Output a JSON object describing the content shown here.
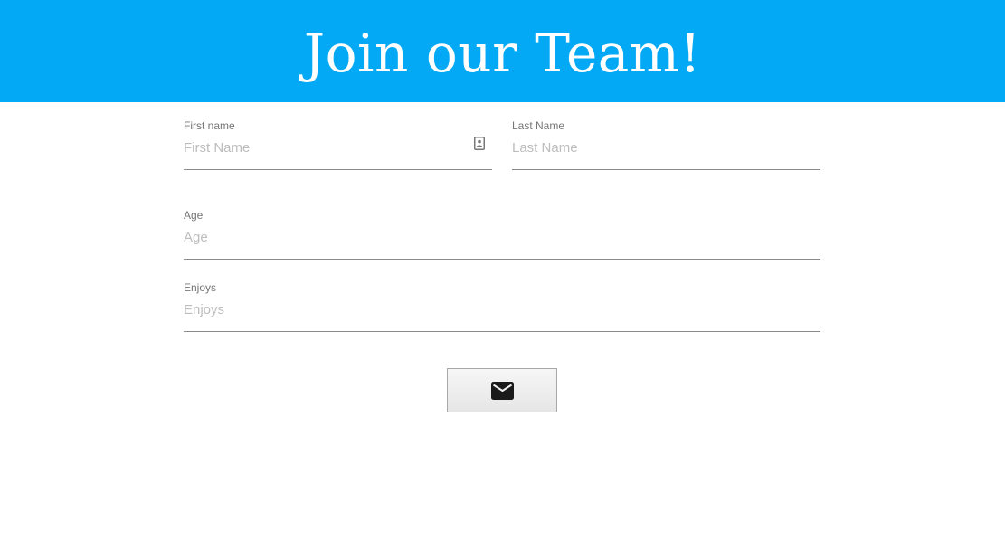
{
  "header": {
    "title": "Join our Team!",
    "background_color": "#03A9F4"
  },
  "form": {
    "first_name": {
      "label": "First name",
      "placeholder": "First Name",
      "value": "",
      "icon": "contact-card-icon"
    },
    "last_name": {
      "label": "Last Name",
      "placeholder": "Last Name",
      "value": ""
    },
    "age": {
      "label": "Age",
      "placeholder": "Age",
      "value": ""
    },
    "enjoys": {
      "label": "Enjoys",
      "placeholder": "Enjoys",
      "value": ""
    },
    "submit": {
      "icon": "envelope-icon"
    }
  }
}
